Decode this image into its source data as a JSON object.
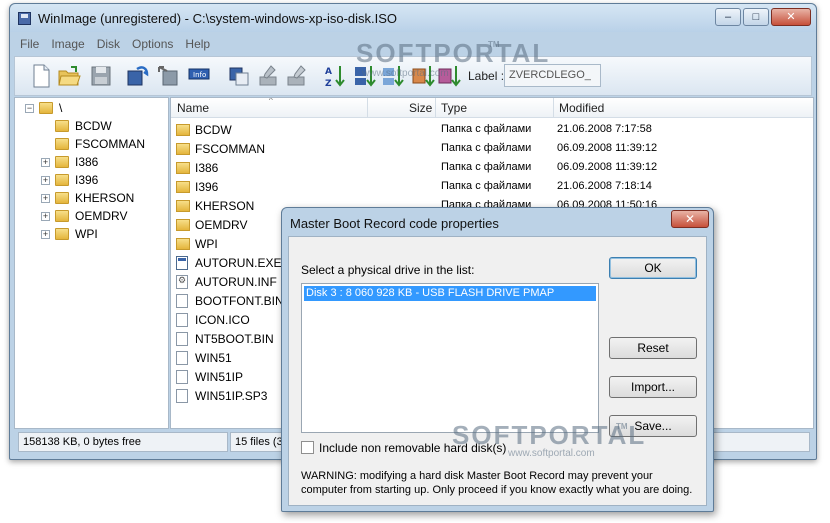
{
  "window": {
    "title": "WinImage (unregistered) - C:\\system-windows-xp-iso-disk.ISO",
    "minimize": "–",
    "maximize": "□",
    "close": "✕"
  },
  "menu": [
    "File",
    "Image",
    "Disk",
    "Options",
    "Help"
  ],
  "toolbar": {
    "label_caption": "Label :",
    "label_value": "ZVERCDLEGO_",
    "icons": [
      "new-icon",
      "open-icon",
      "save-icon",
      "inject-icon",
      "extract-icon",
      "info-icon",
      "copy-icon",
      "paste-icon",
      "edit-icon",
      "sort-az-icon",
      "sort-date-icon",
      "view-icon",
      "disk-icon",
      "disk2-icon"
    ]
  },
  "watermark": {
    "brand": "SOFTPORTAL",
    "tm": "TM",
    "url": "www.softportal.com"
  },
  "tree": {
    "root": "\\",
    "items": [
      {
        "label": "BCDW",
        "expander": ""
      },
      {
        "label": "FSCOMMAN",
        "expander": ""
      },
      {
        "label": "I386",
        "expander": "+"
      },
      {
        "label": "I396",
        "expander": "+"
      },
      {
        "label": "KHERSON",
        "expander": "+"
      },
      {
        "label": "OEMDRV",
        "expander": "+"
      },
      {
        "label": "WPI",
        "expander": "+"
      }
    ]
  },
  "list": {
    "columns": {
      "name": "Name",
      "size": "Size",
      "type": "Type",
      "modified": "Modified"
    },
    "rows": [
      {
        "icon": "folder",
        "name": "BCDW",
        "type": "Папка с файлами",
        "modified": "21.06.2008  7:17:58"
      },
      {
        "icon": "folder",
        "name": "FSCOMMAN",
        "type": "Папка с файлами",
        "modified": "06.09.2008  11:39:12"
      },
      {
        "icon": "folder",
        "name": "I386",
        "type": "Папка с файлами",
        "modified": "06.09.2008  11:39:12"
      },
      {
        "icon": "folder",
        "name": "I396",
        "type": "Папка с файлами",
        "modified": "21.06.2008  7:18:14"
      },
      {
        "icon": "folder",
        "name": "KHERSON",
        "type": "Папка с файлами",
        "modified": "06.09.2008  11:50:16"
      },
      {
        "icon": "folder",
        "name": "OEMDRV",
        "type": "",
        "modified": ""
      },
      {
        "icon": "folder",
        "name": "WPI",
        "type": "",
        "modified": ""
      },
      {
        "icon": "exe",
        "name": "AUTORUN.EXE",
        "type": "",
        "modified": ""
      },
      {
        "icon": "inf",
        "name": "AUTORUN.INF",
        "type": "",
        "modified": ""
      },
      {
        "icon": "file",
        "name": "BOOTFONT.BIN",
        "type": "",
        "modified": ""
      },
      {
        "icon": "file",
        "name": "ICON.ICO",
        "type": "",
        "modified": ""
      },
      {
        "icon": "file",
        "name": "NT5BOOT.BIN",
        "type": "",
        "modified": ""
      },
      {
        "icon": "file",
        "name": "WIN51",
        "type": "",
        "modified": ""
      },
      {
        "icon": "file",
        "name": "WIN51IP",
        "type": "",
        "modified": ""
      },
      {
        "icon": "file",
        "name": "WIN51IP.SP3",
        "type": "",
        "modified": ""
      }
    ]
  },
  "status": {
    "free": "158138 KB, 0 bytes free",
    "files": "15 files (3"
  },
  "dialog": {
    "title": "Master Boot Record code properties",
    "close": "✕",
    "prompt": "Select a physical drive in the list:",
    "selected_drive": "Disk 3 : 8 060 928 KB -  USB FLASH DRIVE PMAP",
    "ok": "OK",
    "reset": "Reset",
    "import": "Import...",
    "save": "Save...",
    "checkbox_label": "Include non removable hard disk(s)",
    "checkbox_checked": false,
    "warning": "WARNING: modifying a hard disk Master Boot Record may prevent your computer from starting up. Only proceed if you know exactly what you are doing."
  }
}
